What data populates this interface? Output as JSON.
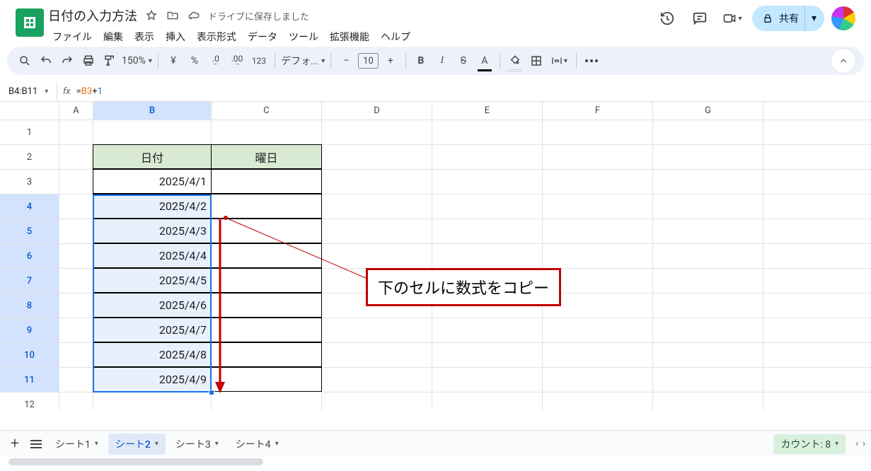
{
  "doc": {
    "title": "日付の入力方法",
    "save_status": "ドライブに保存しました"
  },
  "menus": [
    "ファイル",
    "編集",
    "表示",
    "挿入",
    "表示形式",
    "データ",
    "ツール",
    "拡張機能",
    "ヘルプ"
  ],
  "share_label": "共有",
  "toolbar": {
    "zoom": "150%",
    "currency": "¥",
    "percent": "%",
    "dec_dec": ".0",
    "inc_dec": ".00",
    "num123": "123",
    "font": "デフォ...",
    "font_size": "10",
    "text_color": "#000000",
    "fill_color": "#ffffff"
  },
  "namebox": "B4:B11",
  "formula": {
    "raw": "=B3+1",
    "ref": "B3",
    "num": "1"
  },
  "columns": [
    "A",
    "B",
    "C",
    "D",
    "E",
    "F",
    "G"
  ],
  "rows": [
    "1",
    "2",
    "3",
    "4",
    "5",
    "6",
    "7",
    "8",
    "9",
    "10",
    "11",
    "12"
  ],
  "selected_col": "B",
  "selected_rows": [
    "4",
    "5",
    "6",
    "7",
    "8",
    "9",
    "10",
    "11"
  ],
  "table": {
    "header": {
      "b": "日付",
      "c": "曜日"
    },
    "b_values": [
      "2025/4/1",
      "2025/4/2",
      "2025/4/3",
      "2025/4/4",
      "2025/4/5",
      "2025/4/6",
      "2025/4/7",
      "2025/4/8",
      "2025/4/9"
    ]
  },
  "annotation": "下のセルに数式をコピー",
  "sheets": [
    "シート1",
    "シート2",
    "シート3",
    "シート4"
  ],
  "active_sheet": "シート2",
  "status": {
    "count_label": "カウント: 8"
  }
}
